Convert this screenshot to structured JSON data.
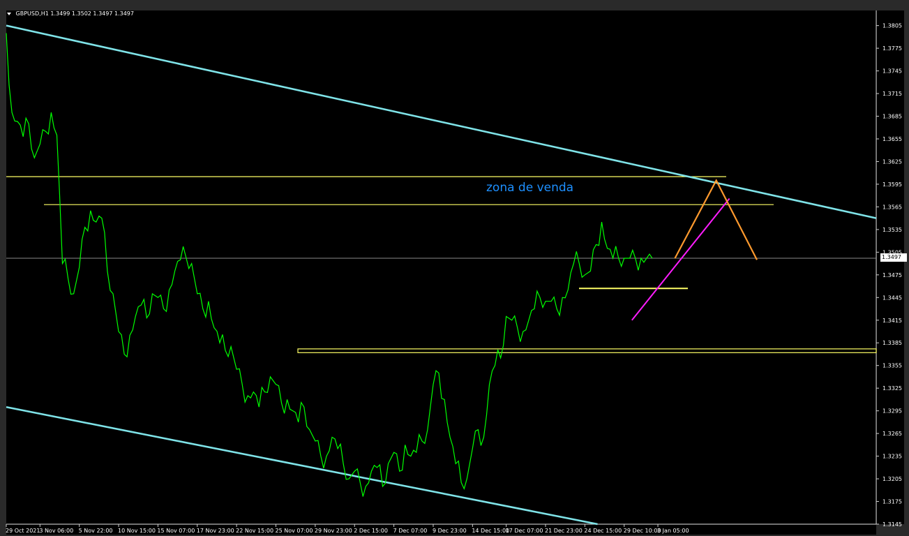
{
  "header": {
    "symbol": "GBPUSD,H1",
    "ohlc": "1.3499 1.3502 1.3497 1.3497"
  },
  "annotation_text": "zona de venda",
  "current_price_label": "1.3497",
  "colors": {
    "background": "#000000",
    "frame": "#2a2a2a",
    "price_line": "#00ff00",
    "channel": "#7fe3e8",
    "horizontal_levels": "#ffff66",
    "magenta_trend": "#ff1dff",
    "orange_projection": "#ff9a2e",
    "annotation": "#1e90ff",
    "axis_text": "#ffffff",
    "current_price_line": "#8a8a8a"
  },
  "chart_data": {
    "type": "line",
    "series": [
      {
        "name": "",
        "x": [
          0,
          8,
          16,
          24,
          32,
          40,
          48,
          56,
          64,
          72,
          80,
          88,
          96,
          104,
          112,
          120,
          128,
          136,
          144,
          152,
          160,
          168,
          176,
          184,
          192,
          200,
          208,
          216,
          224,
          232,
          240,
          248,
          256,
          264,
          272,
          280,
          288,
          296,
          304,
          312,
          320,
          328,
          336,
          344,
          352,
          360,
          368,
          376,
          384,
          392,
          400,
          408,
          416,
          424,
          432,
          440,
          448,
          456,
          464,
          472,
          480,
          488,
          496,
          504,
          512,
          520,
          528,
          536,
          544,
          552,
          560,
          568,
          576,
          584,
          592,
          600,
          608,
          616,
          624,
          632,
          640,
          648,
          656,
          664,
          672,
          680,
          688,
          696,
          704,
          712,
          720,
          728,
          736,
          744,
          752,
          760,
          768,
          776,
          784,
          792,
          800,
          808,
          816,
          824,
          832,
          840,
          848,
          856,
          864,
          872,
          880,
          888,
          896,
          904,
          912,
          920
        ],
        "values": [
          1.3795,
          1.369,
          1.3678,
          1.3658,
          1.3675,
          1.363,
          1.3648,
          1.3665,
          1.369,
          1.366,
          1.349,
          1.347,
          1.345,
          1.3485,
          1.3538,
          1.356,
          1.3545,
          1.355,
          1.348,
          1.345,
          1.34,
          1.337,
          1.3395,
          1.342,
          1.3435,
          1.3418,
          1.345,
          1.3445,
          1.343,
          1.3455,
          1.348,
          1.3495,
          1.3498,
          1.349,
          1.345,
          1.343,
          1.344,
          1.3405,
          1.3385,
          1.3375,
          1.338,
          1.335,
          1.333,
          1.3315,
          1.332,
          1.33,
          1.332,
          1.334,
          1.333,
          1.3305,
          1.331,
          1.3295,
          1.328,
          1.33,
          1.327,
          1.3255,
          1.3235,
          1.3235,
          1.326,
          1.3245,
          1.3225,
          1.3205,
          1.3215,
          1.32,
          1.3195,
          1.3215,
          1.322,
          1.3195,
          1.3225,
          1.324,
          1.3215,
          1.325,
          1.3235,
          1.324,
          1.3255,
          1.327,
          1.333,
          1.3345,
          1.331,
          1.326,
          1.3225,
          1.32,
          1.3205,
          1.3245,
          1.327,
          1.326,
          1.333,
          1.3355,
          1.3365,
          1.342,
          1.3415,
          1.3405,
          1.34,
          1.3415,
          1.343,
          1.3445,
          1.344,
          1.344,
          1.343,
          1.3445,
          1.3455,
          1.349,
          1.349,
          1.3475,
          1.348,
          1.3515,
          1.3545,
          1.351,
          1.3497,
          1.3497,
          1.3497,
          1.3497,
          1.3497,
          1.3497,
          1.3497,
          1.3497
        ]
      }
    ],
    "ylim": [
      1.3145,
      1.3825
    ],
    "y_ticks": [
      "1.3805",
      "1.3775",
      "1.3745",
      "1.3715",
      "1.3685",
      "1.3655",
      "1.3625",
      "1.3595",
      "1.3565",
      "1.3535",
      "1.3505",
      "1.3475",
      "1.3445",
      "1.3415",
      "1.3385",
      "1.3355",
      "1.3325",
      "1.3295",
      "1.3265",
      "1.3235",
      "1.3205",
      "1.3175",
      "1.3145"
    ],
    "x_ticks": [
      "29 Oct 2021",
      "3 Nov 06:00",
      "5 Nov 22:00",
      "10 Nov 15:00",
      "15 Nov 07:00",
      "17 Nov 23:00",
      "22 Nov 15:00",
      "25 Nov 07:00",
      "29 Nov 23:00",
      "2 Dec 15:00",
      "7 Dec 07:00",
      "9 Dec 23:00",
      "14 Dec 15:00",
      "17 Dec 07:00",
      "21 Dec 23:00",
      "24 Dec 15:00",
      "29 Dec 10:00",
      "3 Jan 05:00"
    ],
    "x_tick_index": [
      0,
      6,
      13,
      20,
      27,
      34,
      41,
      48,
      55,
      62,
      69,
      76,
      83,
      89,
      96,
      103,
      110,
      116
    ],
    "grid": false,
    "levels": {
      "resistance_top": 1.3605,
      "resistance_bottom": 1.3568,
      "support_mid": 1.3457,
      "support_box_top": 1.3377,
      "support_box_bottom": 1.3372,
      "current_price": 1.3497
    },
    "channel_upper": {
      "x": [
        0,
        151.7
      ],
      "y": [
        1.3805,
        1.355
      ]
    },
    "channel_lower": {
      "x": [
        0,
        103.1
      ],
      "y": [
        1.33,
        1.3145
      ]
    },
    "magenta_trend": {
      "x": [
        109.1,
        126.1
      ],
      "y": [
        1.3415,
        1.3576
      ]
    },
    "orange_projection": {
      "x": [
        116.6,
        123.8,
        130.9
      ],
      "y": [
        1.3497,
        1.36,
        1.3495
      ]
    }
  }
}
